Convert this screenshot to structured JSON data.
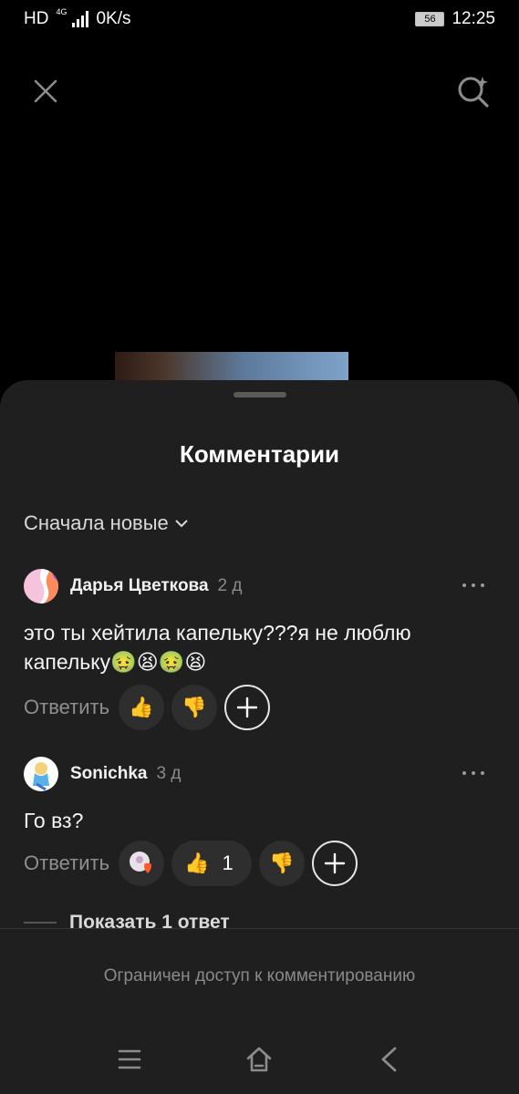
{
  "status_bar": {
    "hd": "HD",
    "network": "4G",
    "speed": "0K/s",
    "battery": "56",
    "time": "12:25"
  },
  "sheet": {
    "title": "Комментарии",
    "sort_label": "Сначала новые",
    "sort_icon": "chevron-down-icon"
  },
  "comments": [
    {
      "author": "Дарья Цветкова",
      "time": "2 д",
      "text": "это ты хейтила капельку???я не люблю капельку🤢😫🤢😫",
      "reply_label": "Ответить",
      "likes": "",
      "icons": [
        "thumbs-up-icon",
        "thumbs-down-icon",
        "add-reaction-icon"
      ]
    },
    {
      "author": "Sonichka",
      "time": "3 д",
      "text": "Го вз?",
      "reply_label": "Ответить",
      "likes": "1",
      "icons": [
        "author-heart-icon",
        "thumbs-up-icon",
        "thumbs-down-icon",
        "add-reaction-icon"
      ]
    }
  ],
  "show_replies": "Показать 1 ответ",
  "footer": {
    "restricted_text": "Ограничен доступ к комментированию"
  },
  "nav": {
    "icons": [
      "menu-icon",
      "home-icon",
      "back-icon"
    ]
  },
  "colors": {
    "sheet_bg": "#1f1f1f",
    "pill_bg": "#2e2e2e",
    "muted_text": "#8a8a8a"
  }
}
